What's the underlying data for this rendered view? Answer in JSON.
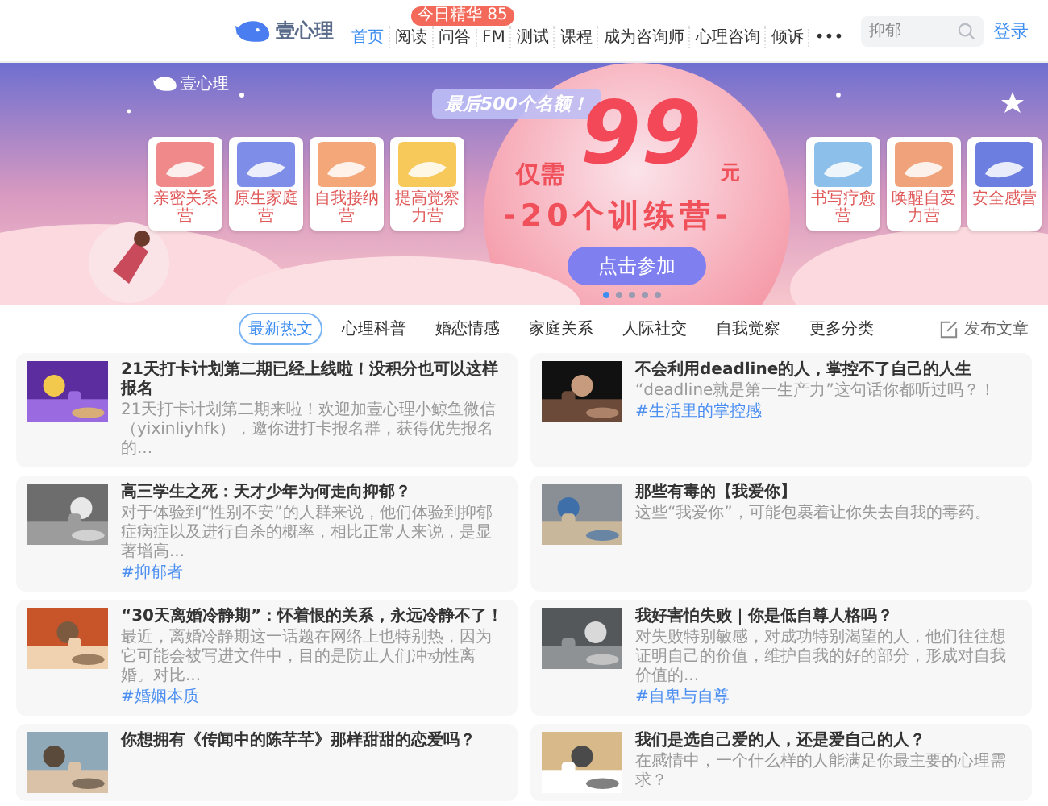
{
  "header": {
    "logo": "壹心理",
    "nav": [
      {
        "label": "首页",
        "selected": true
      },
      {
        "label": "阅读",
        "selected": false
      },
      {
        "label": "问答",
        "selected": false,
        "badge": "今日精华 85"
      },
      {
        "label": "FM",
        "selected": false
      },
      {
        "label": "测试",
        "selected": false
      },
      {
        "label": "课程",
        "selected": false
      },
      {
        "label": "成为咨询师",
        "selected": false
      },
      {
        "label": "心理咨询",
        "selected": false
      },
      {
        "label": "倾诉",
        "selected": false
      },
      {
        "label": "•••",
        "selected": false
      }
    ],
    "search": {
      "placeholder": "抑郁"
    },
    "login": "登录"
  },
  "banner": {
    "logo": "壹心理",
    "promo": "最后500个名额！",
    "price_prefix": "仅需",
    "price": "99",
    "price_unit": "元",
    "headline": "-20个训练营-",
    "cta": "点击参加",
    "camps_left": [
      "亲密关系营",
      "原生家庭营",
      "自我接纳营",
      "提高觉察力营"
    ],
    "camps_right": [
      "书写疗愈营",
      "唤醒自爱力营",
      "安全感营"
    ],
    "dots": [
      {
        "selected": true
      },
      {
        "selected": false
      },
      {
        "selected": false
      },
      {
        "selected": false
      },
      {
        "selected": false
      }
    ]
  },
  "category_tabs": [
    {
      "label": "最新热文",
      "selected": true
    },
    {
      "label": "心理科普",
      "selected": false
    },
    {
      "label": "婚恋情感",
      "selected": false
    },
    {
      "label": "家庭关系",
      "selected": false
    },
    {
      "label": "人际社交",
      "selected": false
    },
    {
      "label": "自我觉察",
      "selected": false
    },
    {
      "label": "更多分类",
      "selected": false
    }
  ],
  "publish": "发布文章",
  "articles": [
    {
      "title": "21天打卡计划第二期已经上线啦！没积分也可以这样报名",
      "summary": "21天打卡计划第二期来啦！欢迎加壹心理小鲸鱼微信（yixinliyhfk），邀你进打卡报名群，获得优先报名的..."
    },
    {
      "title": "不会利用deadline的人，掌控不了自己的人生",
      "summary": "“deadline就是第一生产力”这句话你都听过吗？！",
      "tag": "#生活里的掌控感"
    },
    {
      "title": "高三学生之死：天才少年为何走向抑郁？",
      "summary": "对于体验到“性别不安”的人群来说，他们体验到抑郁症病症以及进行自杀的概率，相比正常人来说，是显著增高...",
      "tag": "#抑郁者"
    },
    {
      "title": "那些有毒的【我爱你】",
      "summary": "这些“我爱你”，可能包裹着让你失去自我的毒药。"
    },
    {
      "title": "“30天离婚冷静期”：怀着恨的关系，永远冷静不了！",
      "summary": "最近，离婚冷静期这一话题在网络上也特别热，因为它可能会被写进文件中，目的是防止人们冲动性离婚。对比...",
      "tag": "#婚姻本质"
    },
    {
      "title": "我好害怕失败｜你是低自尊人格吗？",
      "summary": "对失败特别敏感，对成功特别渴望的人，他们往往想证明自己的价值，维护自我的好的部分，形成对自我价值的...",
      "tag": "#自卑与自尊"
    },
    {
      "title": "你想拥有《传闻中的陈芊芊》那样甜甜的恋爱吗？"
    },
    {
      "title": "我们是选自己爱的人，还是爱自己的人？",
      "summary": "在感情中，一个什么样的人能满足你最主要的心理需求？"
    }
  ]
}
